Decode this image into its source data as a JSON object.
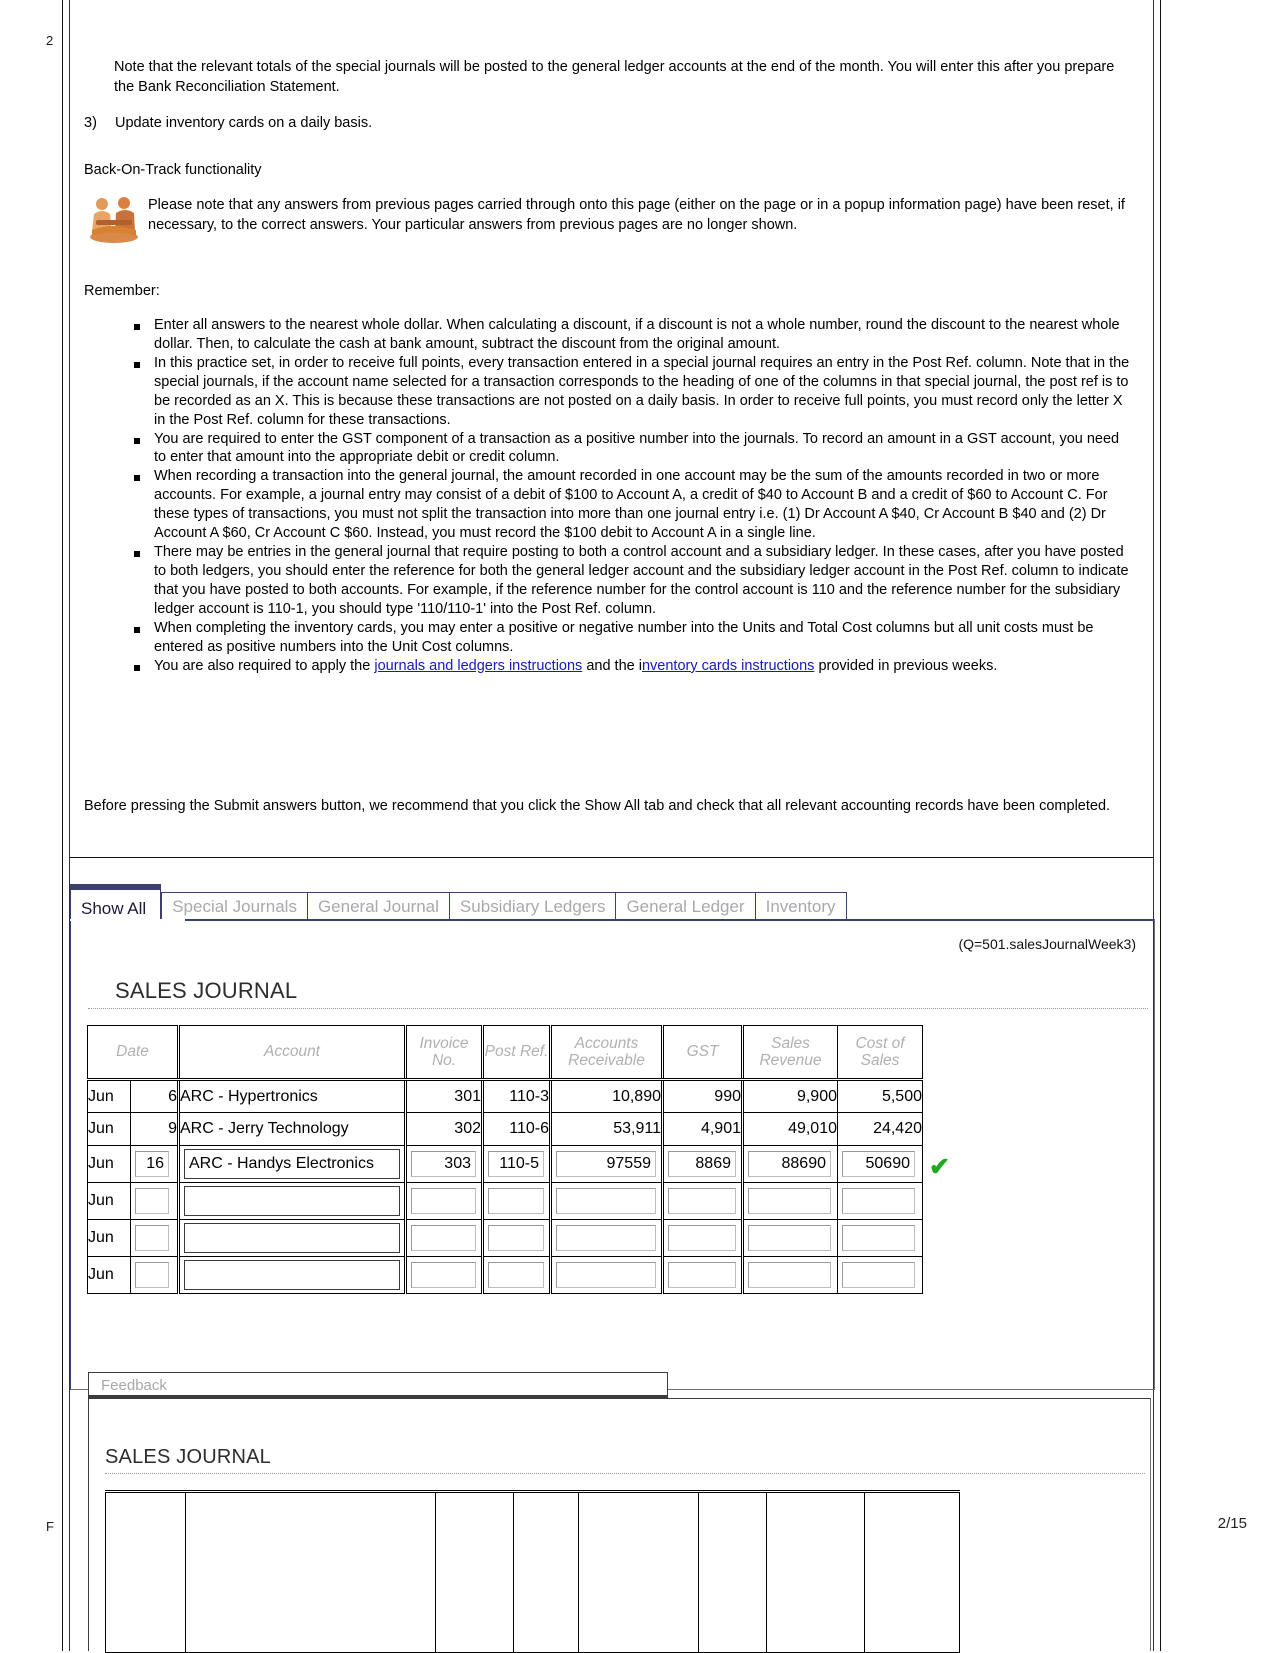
{
  "page": {
    "left_mark_top": "2",
    "left_mark_bottom": "F",
    "page_number": "2/15"
  },
  "intro": {
    "note_paragraph": "Note that the relevant totals of the special journals will be posted to the general ledger accounts at the end of the month. You will enter this after you prepare the Bank Reconciliation Statement.",
    "item3_number": "3)",
    "item3_text": "Update inventory cards on a daily basis.",
    "back_on_track_heading": "Back-On-Track functionality",
    "back_on_track_note": "Please note that any answers from previous pages carried through onto this page (either on the page or in a popup information page) have been reset, if necessary, to the correct answers. Your particular answers from previous pages are no longer shown.",
    "remember_label": "Remember:",
    "bullets": [
      "Enter all answers to the nearest whole dollar. When calculating a discount, if a discount is not a whole number, round the discount to the nearest whole dollar. Then, to calculate the cash at bank amount, subtract the discount from the original amount.",
      "In this practice set, in order to receive full points, every transaction entered in a special journal requires an entry in the Post Ref. column. Note that in the special journals, if the account name selected for a transaction corresponds to the heading of one of the columns in that special journal, the post ref is to be recorded as an X. This is because these transactions are not posted on a daily basis. In order to receive full points, you must record only the letter X in the Post Ref. column for these transactions.",
      "You are required to enter the GST component of a transaction as a positive number into the journals. To record an amount in a GST account, you need to enter that amount into the appropriate debit or credit column.",
      "When recording a transaction into the general journal, the amount recorded in one account may be the sum of the amounts recorded in two or more accounts. For example, a journal entry may consist of a debit of $100 to Account A, a credit of $40 to Account B and a credit of $60 to Account C. For these types of transactions, you must not split the transaction into more than one journal entry i.e. (1) Dr Account A $40, Cr Account B $40 and (2) Dr Account A $60, Cr Account C $60. Instead, you must record the $100 debit to Account A in a single line.",
      "There may be entries in the general journal that require posting to both a control account and a subsidiary ledger. In these cases, after you have posted to both ledgers, you should enter the reference for both the general ledger account and the subsidiary ledger account in the Post Ref. column to indicate that you have posted to both accounts. For example, if the reference number for the control account is 110 and the reference number for the subsidiary ledger account is 110-1, you should type '110/110-1' into the Post Ref. column.",
      "When completing the inventory cards, you may enter a positive or negative number into the Units and Total Cost columns but all unit costs must be entered as positive numbers into the Unit Cost columns."
    ],
    "bullet_link": {
      "prefix": "You are also required to apply the ",
      "link1": "journals and ledgers instructions",
      "middle": " and the i",
      "link2": "nventory cards instructions",
      "suffix": " provided in previous weeks."
    },
    "before_submit": "Before pressing the Submit answers button, we recommend that you click the Show All tab and check that all relevant accounting records have been completed."
  },
  "tabs": [
    {
      "label": "Show All",
      "active": true
    },
    {
      "label": "Special Journals",
      "active": false
    },
    {
      "label": "General Journal",
      "active": false
    },
    {
      "label": "Subsidiary Ledgers",
      "active": false
    },
    {
      "label": "General Ledger",
      "active": false
    },
    {
      "label": "Inventory",
      "active": false
    }
  ],
  "panel": {
    "question_id": "(Q=501.salesJournalWeek3)",
    "journal_title": "SALES JOURNAL",
    "feedback_label": "Feedback",
    "bottom_journal_title": "SALES JOURNAL"
  },
  "sales_journal": {
    "headers": {
      "date": "Date",
      "account": "Account",
      "invoice_no": "Invoice No.",
      "post_ref": "Post Ref.",
      "accounts_receivable": "Accounts Receivable",
      "gst": "GST",
      "sales_revenue": "Sales Revenue",
      "cost_of_sales": "Cost of Sales"
    },
    "rows": [
      {
        "month": "Jun",
        "day": "6",
        "account": "ARC - Hypertronics",
        "invoice_no": "301",
        "post_ref": "110-3",
        "accounts_receivable": "10,890",
        "gst": "990",
        "sales_revenue": "9,900",
        "cost_of_sales": "5,500",
        "editable": false,
        "checked": false
      },
      {
        "month": "Jun",
        "day": "9",
        "account": "ARC - Jerry Technology",
        "invoice_no": "302",
        "post_ref": "110-6",
        "accounts_receivable": "53,911",
        "gst": "4,901",
        "sales_revenue": "49,010",
        "cost_of_sales": "24,420",
        "editable": false,
        "checked": false
      },
      {
        "month": "Jun",
        "day": "16",
        "account": "ARC - Handys Electronics",
        "invoice_no": "303",
        "post_ref": "110-5",
        "accounts_receivable": "97559",
        "gst": "8869",
        "sales_revenue": "88690",
        "cost_of_sales": "50690",
        "editable": true,
        "checked": true,
        "check_glyph": "✔"
      },
      {
        "month": "Jun",
        "day": "",
        "account": "",
        "invoice_no": "",
        "post_ref": "",
        "accounts_receivable": "",
        "gst": "",
        "sales_revenue": "",
        "cost_of_sales": "",
        "editable": true,
        "checked": false
      },
      {
        "month": "Jun",
        "day": "",
        "account": "",
        "invoice_no": "",
        "post_ref": "",
        "accounts_receivable": "",
        "gst": "",
        "sales_revenue": "",
        "cost_of_sales": "",
        "editable": true,
        "checked": false
      },
      {
        "month": "Jun",
        "day": "",
        "account": "",
        "invoice_no": "",
        "post_ref": "",
        "accounts_receivable": "",
        "gst": "",
        "sales_revenue": "",
        "cost_of_sales": "",
        "editable": true,
        "checked": false
      }
    ]
  },
  "colors": {
    "tab_accent": "#3b3f6b",
    "link": "#1717c4",
    "check_green": "#1faa1f",
    "header_gray": "#b0b0b0"
  }
}
